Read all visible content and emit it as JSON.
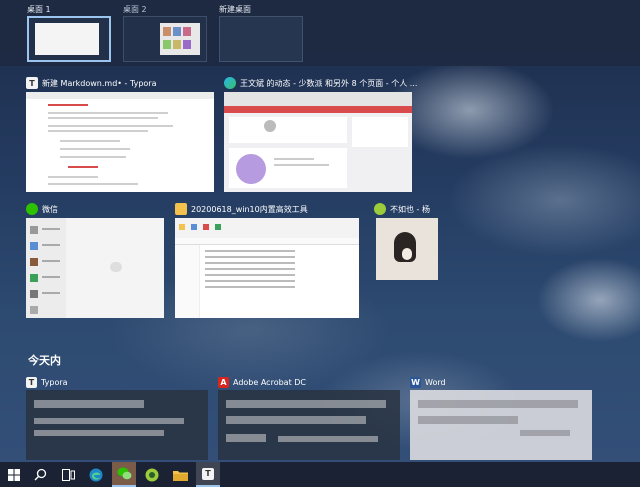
{
  "desktops": [
    {
      "label": "桌面 1",
      "active": true
    },
    {
      "label": "桌面 2",
      "active": false
    },
    {
      "label": "新建桌面",
      "active": false
    }
  ],
  "windows": {
    "typora": {
      "title": "新建 Markdown.md• - Typora",
      "icon": "T"
    },
    "browser": {
      "title": "王文斌 的动态 - 少数派 和另外 8 个页面 - 个人 ..."
    },
    "wechat": {
      "title": "微信"
    },
    "explorer": {
      "title": "20200618_win10内置高效工具"
    },
    "music": {
      "title": "不如也 - 杨"
    }
  },
  "timeline": {
    "section_title": "今天内",
    "items": [
      {
        "app": "Typora",
        "icon": "T"
      },
      {
        "app": "Adobe Acrobat DC",
        "icon": "A"
      },
      {
        "app": "Word",
        "icon": "W"
      }
    ]
  },
  "taskbar": {
    "icons": [
      "windows-start-icon",
      "search-icon",
      "task-view-icon",
      "edge-icon",
      "wechat-icon",
      "music-icon",
      "file-explorer-icon",
      "typora-icon"
    ]
  },
  "colors": {
    "accent": "#9bc4ee",
    "typora_red": "#d94a4a",
    "wechat_green": "#2dc100",
    "acrobat_red": "#d7261e",
    "word_blue": "#2b579a"
  }
}
